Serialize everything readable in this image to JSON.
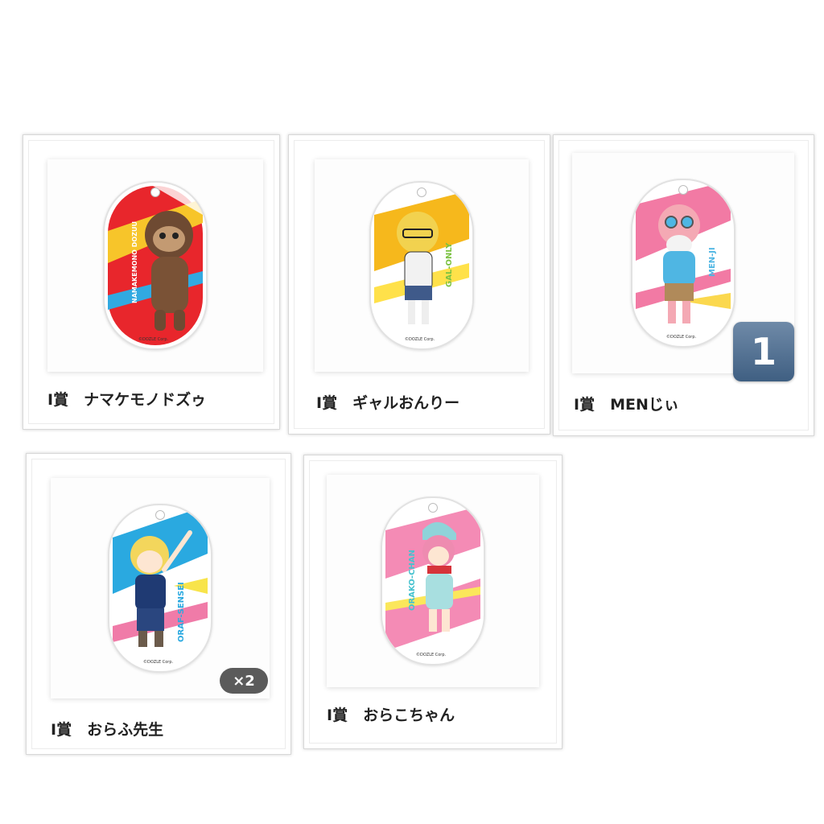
{
  "items": [
    {
      "caption": "I賞　ナマケモノドズゥ",
      "tag_text": "NAMAKEMONO DOZUU",
      "copyright": "©DOZLE Corp.",
      "colors": {
        "bg1": "#e8262c",
        "bg2": "#f7c52a",
        "accent": "#31a9e1",
        "char": "#7a5236"
      },
      "character_icon": "sloth-figure-icon"
    },
    {
      "caption": "I賞　ギャルおんりー",
      "tag_text": "GAL-ONLY",
      "copyright": "©DOZLE Corp.",
      "colors": {
        "bg1": "#f6b81c",
        "bg2": "#ffe14a",
        "accent": "#7cc242",
        "char": "#f2d24f"
      },
      "character_icon": "girl-figure-icon"
    },
    {
      "caption": "I賞　MENじぃ",
      "tag_text": "MEN-JI",
      "copyright": "©DOZLE Corp.",
      "count": "1",
      "colors": {
        "bg1": "#f27aa4",
        "bg2": "#fbd84e",
        "accent": "#4fb6e3",
        "char": "#f4a9b4"
      },
      "character_icon": "pig-figure-icon"
    },
    {
      "caption": "I賞　おらふ先生",
      "tag_text": "ORAF-SENSEI",
      "copyright": "©DOZLE Corp.",
      "quantity": "×2",
      "colors": {
        "bg1": "#2aa9e0",
        "bg2": "#f8e44b",
        "accent": "#f07ba8",
        "char": "#1f3a73"
      },
      "character_icon": "teacher-figure-icon"
    },
    {
      "caption": "I賞　おらこちゃん",
      "tag_text": "ORAKO-CHAN",
      "copyright": "©DOZLE Corp.",
      "colors": {
        "bg1": "#f48bb5",
        "bg2": "#fbe75b",
        "accent": "#46c2cf",
        "char": "#ee8bb0"
      },
      "character_icon": "girl-scarf-figure-icon"
    }
  ]
}
